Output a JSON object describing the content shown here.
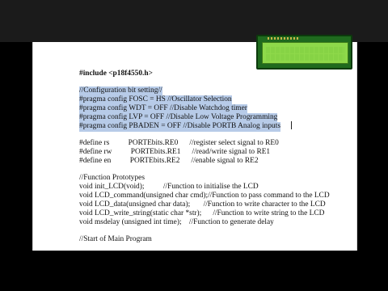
{
  "lines": {
    "l01": "#include <p18f4550.h>",
    "l02": "//Configuration bit setting//",
    "l03": "#pragma config FOSC = HS //Oscillator Selection",
    "l04": "#pragma config WDT = OFF //Disable Watchdog timer",
    "l05": "#pragma config LVP = OFF //Disable Low Voltage Programming",
    "l06": "#pragma config PBADEN = OFF //Disable PORTB Analog inputs",
    "l07": "#define rs          PORTEbits.RE0      //register select signal to RE0",
    "l08": "#define rw          PORTEbits.RE1      //read/write signal to RE1",
    "l09": "#define en          PORTEbits.RE2      //enable signal to RE2",
    "l10": "//Function Prototypes",
    "l11": "void init_LCD(void);          //Function to initialise the LCD",
    "l12": "void LCD_command(unsigned char cmd);//Function to pass command to the LCD",
    "l13": "void LCD_data(unsigned char data);       //Function to write character to the LCD",
    "l14": "void LCD_write_string(static char *str);      //Function to write string to the LCD",
    "l15": "void msdelay (unsigned int time);    //Function to generate delay",
    "l16": "//Start of Main Program"
  },
  "colors": {
    "selection": "#b7cbe8",
    "lcd_backlight": "#8ed94a",
    "lcd_board": "#1f6a1e"
  }
}
